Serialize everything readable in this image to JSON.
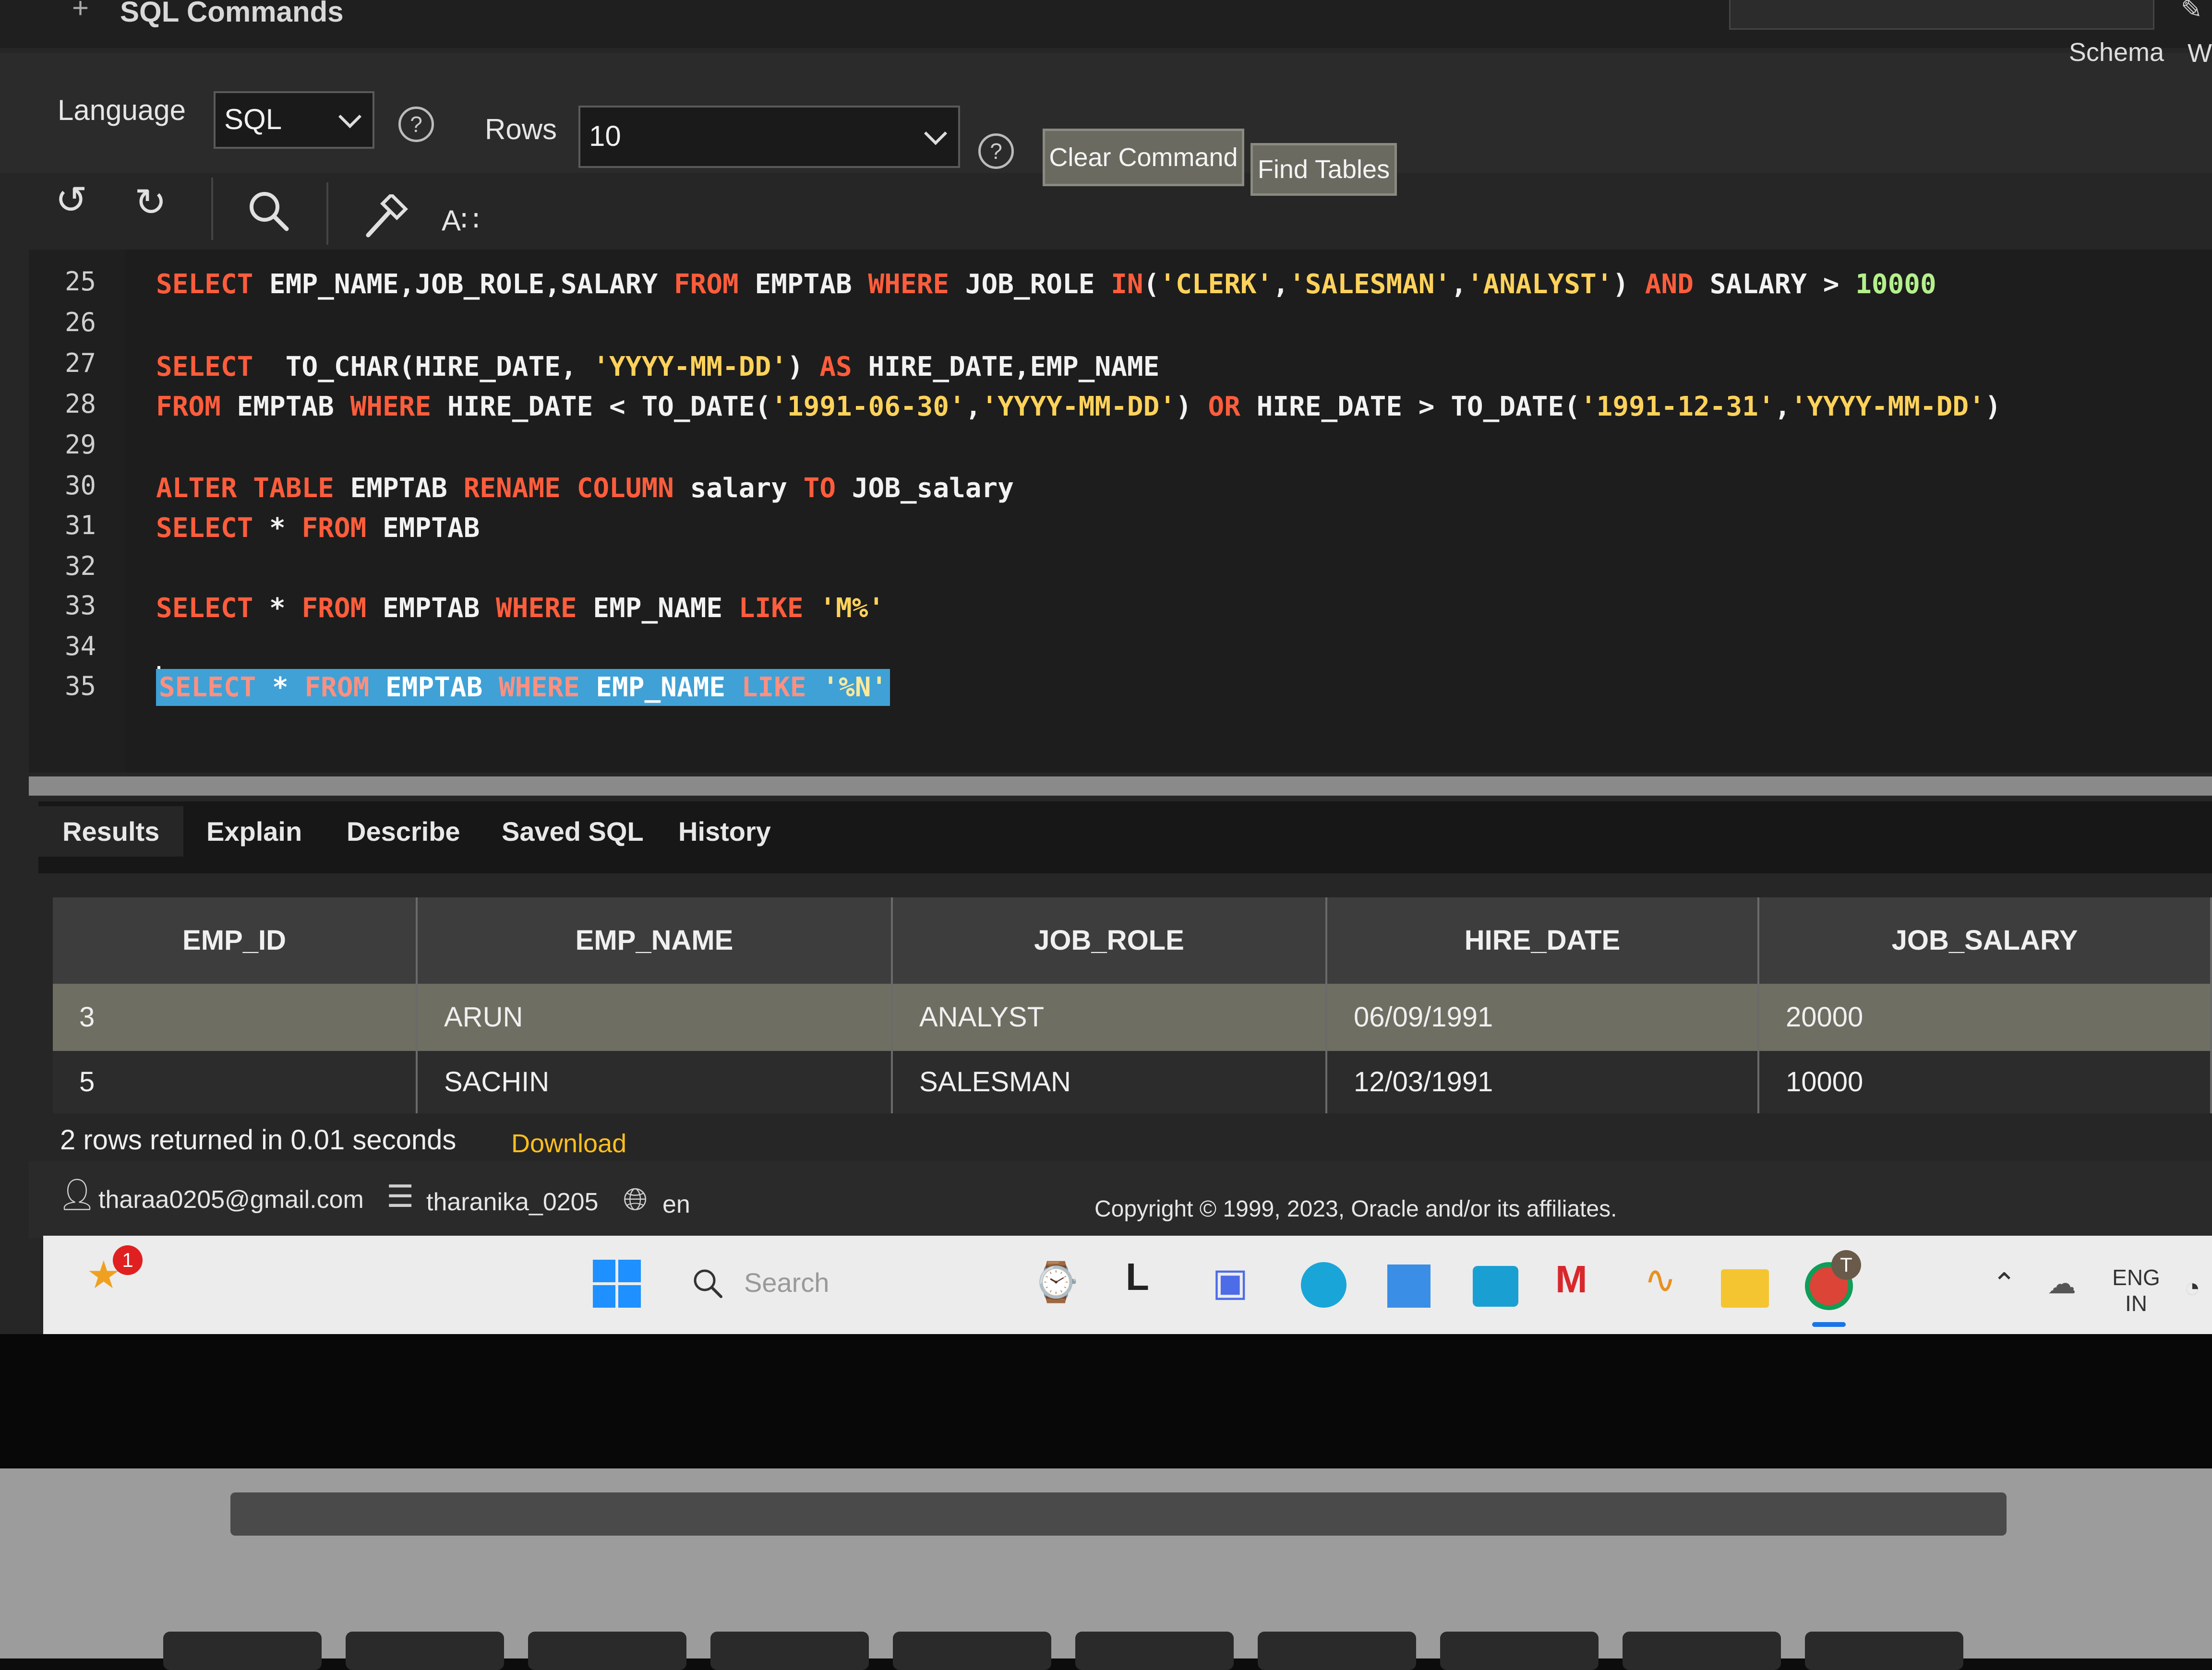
{
  "page": {
    "title": "SQL Commands",
    "schema_label": "Schema",
    "schema_cut": "W"
  },
  "toolbar": {
    "language_label": "Language",
    "language_value": "SQL",
    "rows_label": "Rows",
    "rows_value": "10",
    "help_glyph": "?",
    "clear_command": "Clear Command",
    "find_tables": "Find Tables",
    "format_label": "A∷"
  },
  "editor": {
    "lines": [
      {
        "n": "25"
      },
      {
        "n": "26"
      },
      {
        "n": "27"
      },
      {
        "n": "28"
      },
      {
        "n": "29"
      },
      {
        "n": "30"
      },
      {
        "n": "31"
      },
      {
        "n": "32"
      },
      {
        "n": "33"
      },
      {
        "n": "34"
      },
      {
        "n": "35"
      }
    ],
    "code": {
      "l25": [
        "SELECT",
        " EMP_NAME,JOB_ROLE,SALARY ",
        "FROM",
        " EMPTAB ",
        "WHERE",
        " JOB_ROLE ",
        "IN",
        "(",
        "'CLERK'",
        ",",
        "'SALESMAN'",
        ",",
        "'ANALYST'",
        ") ",
        "AND",
        " SALARY > ",
        "10000"
      ],
      "l27": [
        "SELECT",
        "  TO_CHAR(HIRE_DATE, ",
        "'YYYY-MM-DD'",
        ") ",
        "AS",
        " HIRE_DATE,EMP_NAME"
      ],
      "l28": [
        "FROM",
        " EMPTAB ",
        "WHERE",
        " HIRE_DATE < TO_DATE(",
        "'1991-06-30'",
        ",",
        "'YYYY-MM-DD'",
        ") ",
        "OR",
        " HIRE_DATE > TO_DATE(",
        "'1991-12-31'",
        ",",
        "'YYYY-MM-DD'",
        ")"
      ],
      "l30": [
        "ALTER",
        " ",
        "TABLE",
        " EMPTAB ",
        "RENAME",
        " ",
        "COLUMN",
        " salary ",
        "TO",
        " JOB_salary"
      ],
      "l31": [
        "SELECT",
        " * ",
        "FROM",
        " EMPTAB"
      ],
      "l33": [
        "SELECT",
        " * ",
        "FROM",
        " EMPTAB ",
        "WHERE",
        " EMP_NAME ",
        "LIKE",
        " ",
        "'M%'"
      ],
      "l35": [
        "SELECT",
        " * ",
        "FROM",
        " EMPTAB ",
        "WHERE",
        " EMP_NAME ",
        "LIKE",
        " ",
        "'%N'"
      ]
    }
  },
  "tabs": [
    "Results",
    "Explain",
    "Describe",
    "Saved SQL",
    "History"
  ],
  "results": {
    "columns": [
      "EMP_ID",
      "EMP_NAME",
      "JOB_ROLE",
      "HIRE_DATE",
      "JOB_SALARY"
    ],
    "rows": [
      [
        "3",
        "ARUN",
        "ANALYST",
        "06/09/1991",
        "20000"
      ],
      [
        "5",
        "SACHIN",
        "SALESMAN",
        "12/03/1991",
        "10000"
      ]
    ],
    "status": "2 rows returned in 0.01 seconds",
    "download": "Download"
  },
  "footer": {
    "user": "tharaa0205@gmail.com",
    "workspace": "tharanika_0205",
    "language": "en",
    "copyright": "Copyright © 1999, 2023, Oracle and/or its affiliates."
  },
  "taskbar": {
    "search_placeholder": "Search",
    "notification_count": "1",
    "chrome_badge": "T",
    "lang_line1": "ENG",
    "lang_line2": "IN"
  },
  "colors": {
    "keyword": "#ff5d3c",
    "string": "#ffd25a",
    "number": "#b4f08c",
    "selection": "#3fa1d6",
    "download_link": "#ffbf1e"
  }
}
